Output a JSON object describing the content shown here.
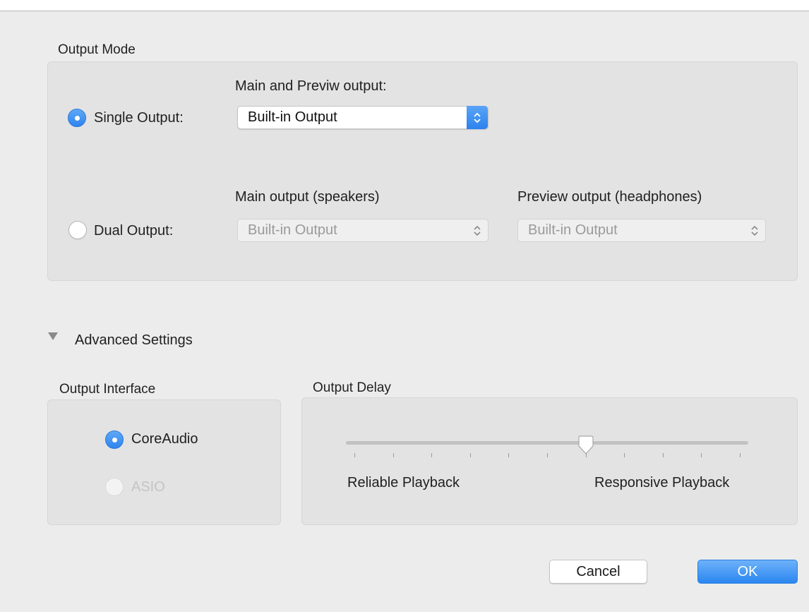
{
  "output_mode": {
    "title": "Output Mode",
    "single": {
      "label": "Single Output:",
      "selected": true,
      "select_caption": "Main and Previw output:",
      "select_value": "Built-in Output"
    },
    "dual": {
      "label": "Dual Output:",
      "selected": false,
      "main_caption": "Main output (speakers)",
      "main_value": "Built-in Output",
      "preview_caption": "Preview output (headphones)",
      "preview_value": "Built-in Output"
    }
  },
  "advanced": {
    "label": "Advanced Settings",
    "expanded": true
  },
  "output_interface": {
    "title": "Output Interface",
    "options": [
      {
        "label": "CoreAudio",
        "selected": true,
        "enabled": true
      },
      {
        "label": "ASIO",
        "selected": false,
        "enabled": false
      }
    ]
  },
  "output_delay": {
    "title": "Output Delay",
    "left_label": "Reliable Playback",
    "right_label": "Responsive Playback",
    "tick_count": 11,
    "value_fraction": 0.6
  },
  "buttons": {
    "cancel": "Cancel",
    "ok": "OK"
  },
  "colors": {
    "accent": "#2f84ee",
    "window_bg": "#ececec",
    "group_bg": "#e3e3e3"
  }
}
